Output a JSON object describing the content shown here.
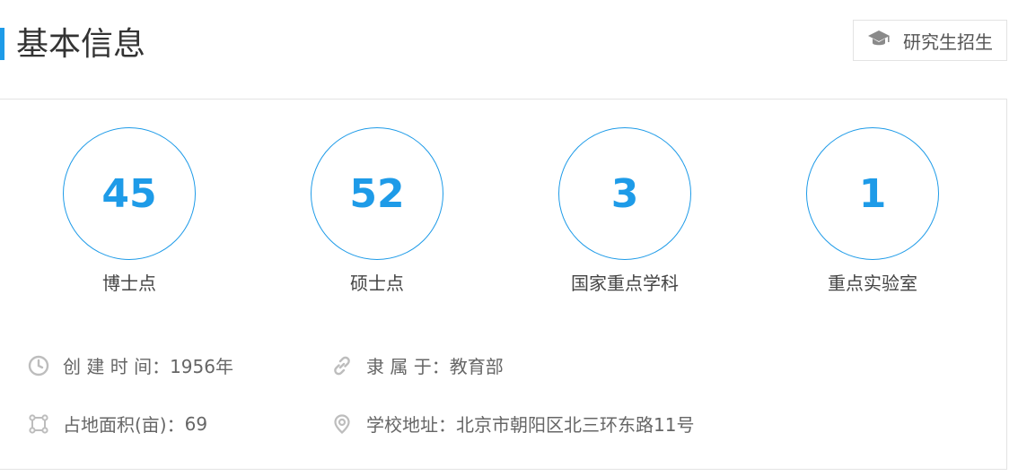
{
  "header": {
    "title": "基本信息",
    "admission_button": {
      "label": "研究生招生",
      "icon": "graduation-cap-icon"
    }
  },
  "stats": [
    {
      "value": "45",
      "label": "博士点"
    },
    {
      "value": "52",
      "label": "硕士点"
    },
    {
      "value": "3",
      "label": "国家重点学科"
    },
    {
      "value": "1",
      "label": "重点实验室"
    }
  ],
  "info": {
    "founded": {
      "label": "创 建 时 间：",
      "value": "1956年",
      "icon": "clock-icon"
    },
    "affiliation": {
      "label": "隶 属 于：",
      "value": "教育部",
      "icon": "link-icon"
    },
    "area": {
      "label": "占地面积(亩)：",
      "value": "69",
      "icon": "area-icon"
    },
    "address": {
      "label": "学校地址：",
      "value": "北京市朝阳区北三环东路11号",
      "icon": "location-icon"
    }
  },
  "colors": {
    "accent": "#1e9be8",
    "icon_gray": "#bdbdbd",
    "text": "#333333"
  }
}
